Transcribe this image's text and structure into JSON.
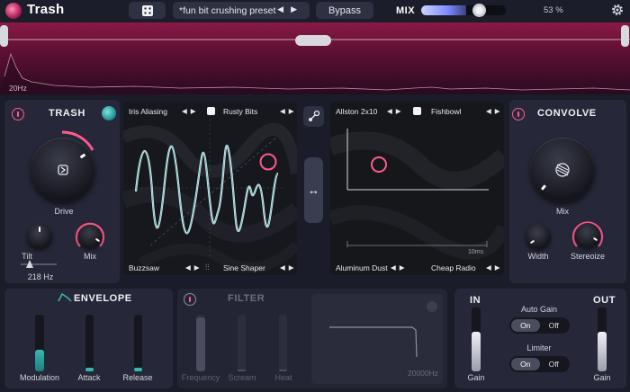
{
  "header": {
    "app_title": "Trash",
    "preset_name": "*fun bit crushing preset",
    "bypass_label": "Bypass",
    "mix_label": "MIX",
    "mix_value": "53 %",
    "mix_level": 0.53
  },
  "spectrum": {
    "freq_label": "20Hz"
  },
  "trash_section": {
    "title": "TRASH",
    "drive_label": "Drive",
    "tilt_label": "Tilt",
    "tilt_freq": "218 Hz",
    "mix_label": "Mix"
  },
  "module_a": {
    "top_left": "Iris Aliasing",
    "top_right": "Rusty Bits",
    "bottom_left": "Buzzsaw",
    "bottom_right": "Sine Shaper"
  },
  "module_b": {
    "top_left": "Allston 2x10",
    "top_right": "Fishbowl",
    "bottom_left": "Aluminum Dust",
    "bottom_right": "Cheap Radio",
    "time_label": "10ms"
  },
  "convolve_section": {
    "title": "CONVOLVE",
    "mix_label": "Mix",
    "width_label": "Width",
    "stereoize_label": "Stereoize"
  },
  "envelope_section": {
    "title": "ENVELOPE",
    "sliders": [
      {
        "label": "Modulation",
        "level": 0.38
      },
      {
        "label": "Attack",
        "level": 0.06
      },
      {
        "label": "Release",
        "level": 0.06
      }
    ]
  },
  "filter_section": {
    "title": "FILTER",
    "sliders": [
      {
        "label": "Frequency",
        "level": 0.95
      },
      {
        "label": "Scream",
        "level": 0.03
      },
      {
        "label": "Heat",
        "level": 0.03
      }
    ],
    "freq_readout": "20000Hz"
  },
  "io_section": {
    "in_label": "IN",
    "out_label": "OUT",
    "in_gain_label": "Gain",
    "out_gain_label": "Gain",
    "in_level": 0.62,
    "out_level": 0.62,
    "auto_gain_label": "Auto Gain",
    "limiter_label": "Limiter",
    "on_label": "On",
    "off_label": "Off"
  },
  "colors": {
    "accent_pink": "#ff5a8c",
    "teal": "#3ab6b0",
    "background": "#1a1c2a"
  }
}
